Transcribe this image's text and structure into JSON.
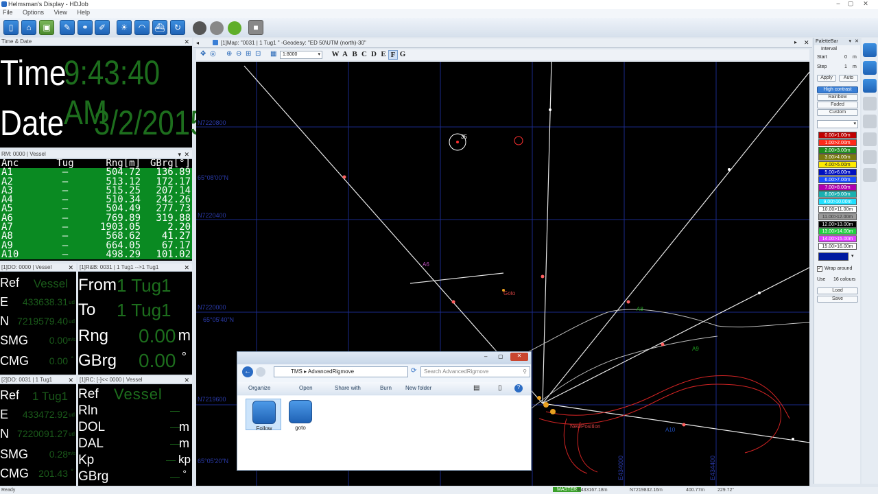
{
  "window": {
    "title": "Helmsman's Display - HDJob"
  },
  "menu": [
    "File",
    "Options",
    "View",
    "Help"
  ],
  "time_panel": {
    "header": "Time & Date",
    "time_label": "Time",
    "time_value": "9:43:40 AM",
    "date_label": "Date",
    "date_value": "3/2/2015"
  },
  "rm_panel": {
    "header": "RM: 0000 | Vessel",
    "columns": [
      "Anc",
      "Tug",
      "Rng[m]",
      "GBrg[°]"
    ],
    "rows": [
      [
        "A1",
        "—",
        "504.72",
        "136.89"
      ],
      [
        "A2",
        "—",
        "513.12",
        "172.17"
      ],
      [
        "A3",
        "—",
        "515.25",
        "207.14"
      ],
      [
        "A4",
        "—",
        "510.34",
        "242.26"
      ],
      [
        "A5",
        "—",
        "504.49",
        "277.73"
      ],
      [
        "A6",
        "—",
        "769.89",
        "319.88"
      ],
      [
        "A7",
        "—",
        "1903.05",
        "2.20"
      ],
      [
        "A8",
        "—",
        "568.62",
        "41.27"
      ],
      [
        "A9",
        "—",
        "664.05",
        "67.17"
      ],
      [
        "A10",
        "—",
        "498.29",
        "101.02"
      ]
    ]
  },
  "do_panel_1": {
    "header": "[1]DO: 0000 | Vessel",
    "ref_label": "Ref",
    "ref_value": "Vessel",
    "e_label": "E",
    "e_value": "433638.31",
    "e_unit": "ud",
    "n_label": "N",
    "n_value": "7219579.40",
    "n_unit": "ud",
    "smg_label": "SMG",
    "smg_value": "0.00",
    "smg_unit": "m/s",
    "cmg_label": "CMG",
    "cmg_value": "0.00",
    "cmg_unit": "°"
  },
  "rb_panel": {
    "header": "[1]R&B: 0031 | 1 Tug1 -->1 Tug1",
    "from_label": "From",
    "from_value": "1 Tug1",
    "to_label": "To",
    "to_value": "1 Tug1",
    "rng_label": "Rng",
    "rng_value": "0.00",
    "rng_unit": "m",
    "gbrg_label": "GBrg",
    "gbrg_value": "0.00",
    "gbrg_unit": "°"
  },
  "do_panel_2": {
    "header": "[2]DO: 0031 | 1 Tug1",
    "ref_label": "Ref",
    "ref_value": "1 Tug1",
    "e_label": "E",
    "e_value": "433472.92",
    "e_unit": "ud",
    "n_label": "N",
    "n_value": "7220091.27",
    "n_unit": "ud",
    "smg_label": "SMG",
    "smg_value": "0.28",
    "smg_unit": "m/s",
    "cmg_label": "CMG",
    "cmg_value": "201.43",
    "cmg_unit": "°"
  },
  "rc_panel": {
    "header": "[1]RC: [-]<< 0000 | Vessel",
    "ref_label": "Ref",
    "ref_value": "Vessel",
    "rln_label": "Rln",
    "rln_value": "—",
    "dol_label": "DOL",
    "dol_value": "—",
    "dol_unit": "m",
    "dal_label": "DAL",
    "dal_value": "—",
    "dal_unit": "m",
    "kp_label": "Kp",
    "kp_value": "—",
    "kp_unit": "kp",
    "gbrg_label": "GBrg",
    "gbrg_value": "—",
    "gbrg_unit": "°"
  },
  "map": {
    "tab": "[1]Map: \"0031 | 1 Tug1 \" -Geodesy: \"ED 50\\UTM (north)-30\"",
    "scale": "1:8000",
    "layers": [
      "W",
      "A",
      "B",
      "C",
      "D",
      "E",
      "F",
      "G"
    ],
    "grid_labels": [
      "N7220800",
      "N7220400",
      "N7220000",
      "N7219600",
      "65°08'00\"N",
      "65°05'40\"N",
      "65°05'20\"N",
      "E434000",
      "E434400"
    ],
    "anchor_labels": [
      "A6",
      "A8",
      "A9",
      "A10",
      "Goto",
      "NewPosition",
      "35"
    ]
  },
  "explorer": {
    "path_root": "TMS",
    "path_folder": "AdvancedRigmove",
    "search_placeholder": "Search AdvancedRigmove",
    "buttons": [
      "Organize",
      "Open",
      "Share with",
      "Burn",
      "New folder"
    ],
    "files": [
      {
        "name": "Follow",
        "icon": "anchor-icon"
      },
      {
        "name": "goto",
        "icon": "helm-icon"
      }
    ]
  },
  "palette": {
    "header": "PaletteBar",
    "interval_label": "Interval",
    "start_label": "Start",
    "start_value": "0",
    "start_unit": "m",
    "step_label": "Step",
    "step_value": "1",
    "step_unit": "m",
    "apply": "Apply",
    "auto": "Auto",
    "modes": [
      "High contrast",
      "Rainbow",
      "Faded",
      "Custom"
    ],
    "colors": [
      {
        "label": "0.00>1.00m",
        "bg": "#c00000",
        "fg": "#ffffff"
      },
      {
        "label": "1.00>2.00m",
        "bg": "#ff2a1a",
        "fg": "#ffffff"
      },
      {
        "label": "2.00>3.00m",
        "bg": "#1e8c1e",
        "fg": "#ffffff"
      },
      {
        "label": "3.00>4.00m",
        "bg": "#7a7a10",
        "fg": "#ffffff"
      },
      {
        "label": "4.00>5.00m",
        "bg": "#ffea00",
        "fg": "#222222"
      },
      {
        "label": "5.00>6.00m",
        "bg": "#0010c0",
        "fg": "#ffffff"
      },
      {
        "label": "6.00>7.00m",
        "bg": "#1a4fff",
        "fg": "#ffffff"
      },
      {
        "label": "7.00>8.00m",
        "bg": "#b000b0",
        "fg": "#ffffff"
      },
      {
        "label": "8.00>9.00m",
        "bg": "#1ab0b0",
        "fg": "#ffffff"
      },
      {
        "label": "9.00>10.00m",
        "bg": "#20e0ff",
        "fg": "#ffffff"
      },
      {
        "label": "10.00>11.00m",
        "bg": "#ffffff",
        "fg": "#222222"
      },
      {
        "label": "11.00>12.00m",
        "bg": "#9a9a9a",
        "fg": "#333333"
      },
      {
        "label": "12.00>13.00m",
        "bg": "#000000",
        "fg": "#ffffff"
      },
      {
        "label": "13.00>14.00m",
        "bg": "#20d040",
        "fg": "#ffffff"
      },
      {
        "label": "14.00>15.00m",
        "bg": "#e040ff",
        "fg": "#ffffff"
      },
      {
        "label": "15.00>16.00m",
        "bg": "#ffffff",
        "fg": "#222222"
      }
    ],
    "wrap_label": "Wrap around",
    "use_label": "Use",
    "use_value": "16 colours",
    "load": "Load",
    "save": "Save"
  },
  "status": {
    "left": "Ready",
    "master": "MASTER",
    "e": "E433167.18m",
    "n": "N7219832.16m",
    "rng": "400.77m",
    "brg": "229.72°"
  }
}
